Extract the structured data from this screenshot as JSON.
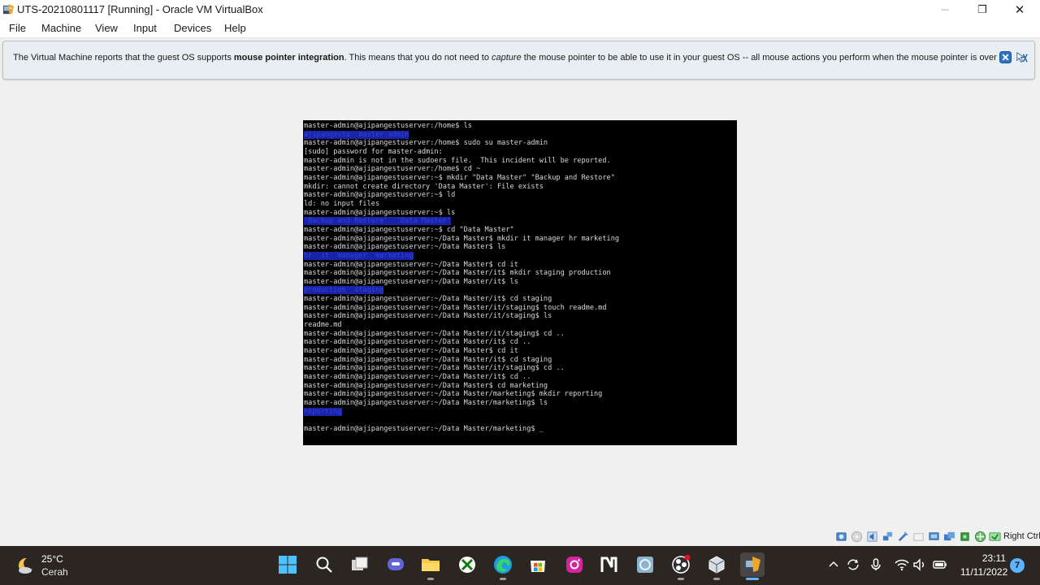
{
  "window": {
    "title": "UTS-20210801117 [Running] - Oracle VM VirtualBox",
    "minimize": "─",
    "restore": "❐",
    "close": "✕"
  },
  "menu": [
    "File",
    "Machine",
    "View",
    "Input",
    "Devices",
    "Help"
  ],
  "notice": {
    "part1": "The Virtual Machine reports that the guest OS supports ",
    "bold": "mouse pointer integration",
    "part2": ". This means that you do not need to ",
    "italic": "capture",
    "part3": " the mouse pointer to be able to use it in your guest OS -- all mouse actions you perform when the mouse pointer is over"
  },
  "terminal": {
    "lines": [
      "master-admin@ajipangestuserver:/home$ ls",
      {
        "dir": "ajipangestu  master-admin"
      },
      "master-admin@ajipangestuserver:/home$ sudo su master-admin",
      "[sudo] password for master-admin:",
      "master-admin is not in the sudoers file.  This incident will be reported.",
      "master-admin@ajipangestuserver:/home$ cd ~",
      "master-admin@ajipangestuserver:~$ mkdir \"Data Master\" \"Backup and Restore\"",
      "mkdir: cannot create directory 'Data Master': File exists",
      "master-admin@ajipangestuserver:~$ ld",
      "ld: no input files",
      "master-admin@ajipangestuserver:~$ ls",
      {
        "dir": "'Backup and Restore'  'Data Master'"
      },
      "master-admin@ajipangestuserver:~$ cd \"Data Master\"",
      "master-admin@ajipangestuserver:~/Data Master$ mkdir it manager hr marketing",
      "master-admin@ajipangestuserver:~/Data Master$ ls",
      {
        "dir": "hr  it  manager  marketing"
      },
      "master-admin@ajipangestuserver:~/Data Master$ cd it",
      "master-admin@ajipangestuserver:~/Data Master/it$ mkdir staging production",
      "master-admin@ajipangestuserver:~/Data Master/it$ ls",
      {
        "dir": "production  staging"
      },
      "master-admin@ajipangestuserver:~/Data Master/it$ cd staging",
      "master-admin@ajipangestuserver:~/Data Master/it/staging$ touch readme.md",
      "master-admin@ajipangestuserver:~/Data Master/it/staging$ ls",
      "readme.md",
      "master-admin@ajipangestuserver:~/Data Master/it/staging$ cd ..",
      "master-admin@ajipangestuserver:~/Data Master/it$ cd ..",
      "master-admin@ajipangestuserver:~/Data Master$ cd it",
      "master-admin@ajipangestuserver:~/Data Master/it$ cd staging",
      "master-admin@ajipangestuserver:~/Data Master/it/staging$ cd ..",
      "master-admin@ajipangestuserver:~/Data Master/it$ cd ..",
      "master-admin@ajipangestuserver:~/Data Master$ cd marketing",
      "master-admin@ajipangestuserver:~/Data Master/marketing$ mkdir reporting",
      "master-admin@ajipangestuserver:~/Data Master/marketing$ ls",
      {
        "dir": "reporting"
      },
      "",
      "master-admin@ajipangestuserver:~/Data Master/marketing$ _"
    ]
  },
  "statusbar": {
    "host_key": "Right Ctrl",
    "icons": [
      "hard-disk-icon",
      "optical-drive-icon",
      "audio-icon",
      "network-icon",
      "usb-icon",
      "shared-folders-icon",
      "display-icon",
      "recording-icon",
      "cpu-icon",
      "mouse-integration-icon",
      "keyboard-icon"
    ]
  },
  "taskbar": {
    "weather": {
      "temp": "25°C",
      "desc": "Cerah"
    },
    "apps": [
      "start-icon",
      "search-icon",
      "task-view-icon",
      "teams-icon",
      "file-explorer-icon",
      "xbox-icon",
      "edge-icon",
      "store-icon",
      "instagram-icon",
      "notion-icon",
      "app-icon",
      "obs-icon",
      "virtualbox-icon",
      "virtualbox-vm-icon"
    ],
    "clock": {
      "time": "23:11",
      "date": "11/11/2022"
    },
    "notifications": "7"
  },
  "colors": {
    "accent": "#5fb2ff",
    "terminal_bg": "#000000",
    "dir_color": "#2e47e0"
  }
}
